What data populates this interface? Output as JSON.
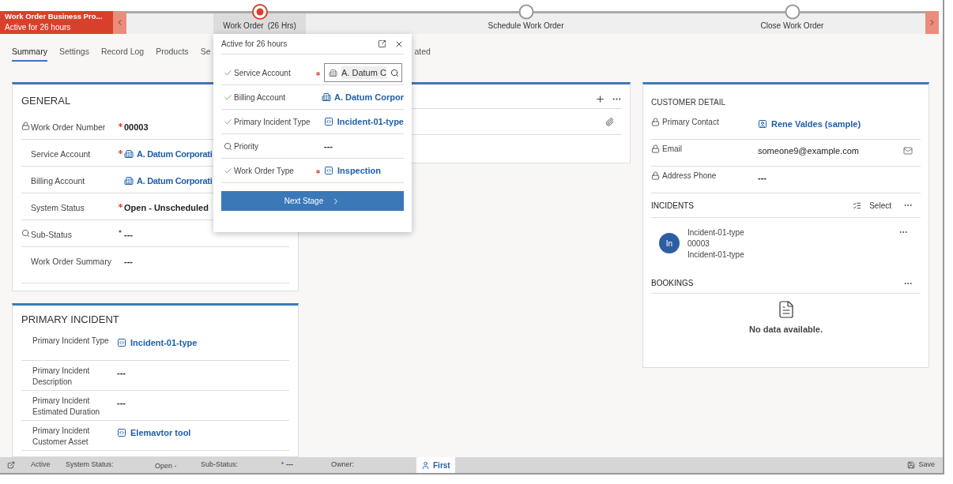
{
  "process": {
    "title": "Work Order Business Pro...",
    "subtitle": "Active for 26 hours",
    "stages": [
      {
        "name": "Work Order",
        "duration": "(26 Hrs)",
        "selected": true
      },
      {
        "name": "Schedule Work Order",
        "selected": false
      },
      {
        "name": "Close Work Order",
        "selected": false
      }
    ]
  },
  "tabs": [
    {
      "label": "Summary",
      "selected": true
    },
    {
      "label": "Settings",
      "selected": false
    },
    {
      "label": "Record Log",
      "selected": false
    },
    {
      "label": "Products",
      "selected": false
    },
    {
      "label": "Se",
      "selected": false
    },
    {
      "label": "ated",
      "selected": false
    }
  ],
  "general": {
    "title": "GENERAL",
    "fields": [
      {
        "label": "Work Order Number",
        "locked": true,
        "search_hint": false,
        "required": true,
        "recommended": false,
        "value": "00003",
        "kind": "text"
      },
      {
        "label": "Service Account",
        "locked": false,
        "search_hint": false,
        "required": true,
        "recommended": false,
        "value": "A. Datum Corporati",
        "kind": "account"
      },
      {
        "label": "Billing Account",
        "locked": false,
        "search_hint": false,
        "required": false,
        "recommended": false,
        "value": "A. Datum Corporati",
        "kind": "account"
      },
      {
        "label": "System Status",
        "locked": false,
        "search_hint": false,
        "required": true,
        "recommended": false,
        "value": "Open - Unscheduled",
        "kind": "text"
      },
      {
        "label": "Sub-Status",
        "locked": false,
        "search_hint": true,
        "required": false,
        "recommended": true,
        "value": "---",
        "kind": "text"
      },
      {
        "label": "Work Order Summary",
        "locked": false,
        "search_hint": false,
        "required": false,
        "recommended": false,
        "value": "---",
        "kind": "text"
      }
    ]
  },
  "primary_incident": {
    "title": "PRIMARY INCIDENT",
    "fields": [
      {
        "label": "Primary Incident Type",
        "value": "Incident-01-type",
        "kind": "incident"
      },
      {
        "label": "Primary Incident Description",
        "value": "---",
        "kind": "text"
      },
      {
        "label": "Primary Incident Estimated Duration",
        "value": "---",
        "kind": "text"
      },
      {
        "label": "Primary Incident Customer Asset",
        "value": "Elemavtor tool",
        "kind": "incident"
      }
    ]
  },
  "popup": {
    "title": "Active for 26 hours",
    "fields": [
      {
        "label": "Service Account",
        "completed": true,
        "search_hint": false,
        "required": true,
        "value": "A. Datum C",
        "kind": "input"
      },
      {
        "label": "Billing Account",
        "completed": true,
        "search_hint": false,
        "required": false,
        "value": "A. Datum Corpor",
        "kind": "account"
      },
      {
        "label": "Primary Incident Type",
        "completed": true,
        "search_hint": false,
        "required": false,
        "value": "Incident-01-type",
        "kind": "incident"
      },
      {
        "label": "Priority",
        "completed": false,
        "search_hint": true,
        "required": false,
        "value": "---",
        "kind": "text"
      },
      {
        "label": "Work Order Type",
        "completed": true,
        "search_hint": false,
        "required": true,
        "value": "Inspection",
        "kind": "incident"
      }
    ],
    "button": "Next Stage"
  },
  "customer": {
    "title": "CUSTOMER DETAIL",
    "fields": [
      {
        "label": "Primary Contact",
        "locked": true,
        "value": "Rene Valdes (sample)",
        "kind": "contact"
      },
      {
        "label": "Email",
        "locked": true,
        "value": "someone9@example.com",
        "kind": "email"
      },
      {
        "label": "Address Phone",
        "locked": true,
        "value": "---",
        "kind": "text"
      }
    ]
  },
  "incidents": {
    "title": "INCIDENTS",
    "select": "Select",
    "items": [
      {
        "initials": "In",
        "lines": [
          "Incident-01-type",
          "00003",
          "Incident-01-type"
        ]
      }
    ]
  },
  "bookings": {
    "title": "BOOKINGS",
    "empty": "No data available."
  },
  "status_bar": {
    "state": "Active",
    "system_status_label": "System Status:",
    "system_status": "Open -",
    "sub_status_label": "Sub-Status:",
    "sub_status": "---",
    "owner_label": "Owner:",
    "owner": "First",
    "save": "Save"
  }
}
